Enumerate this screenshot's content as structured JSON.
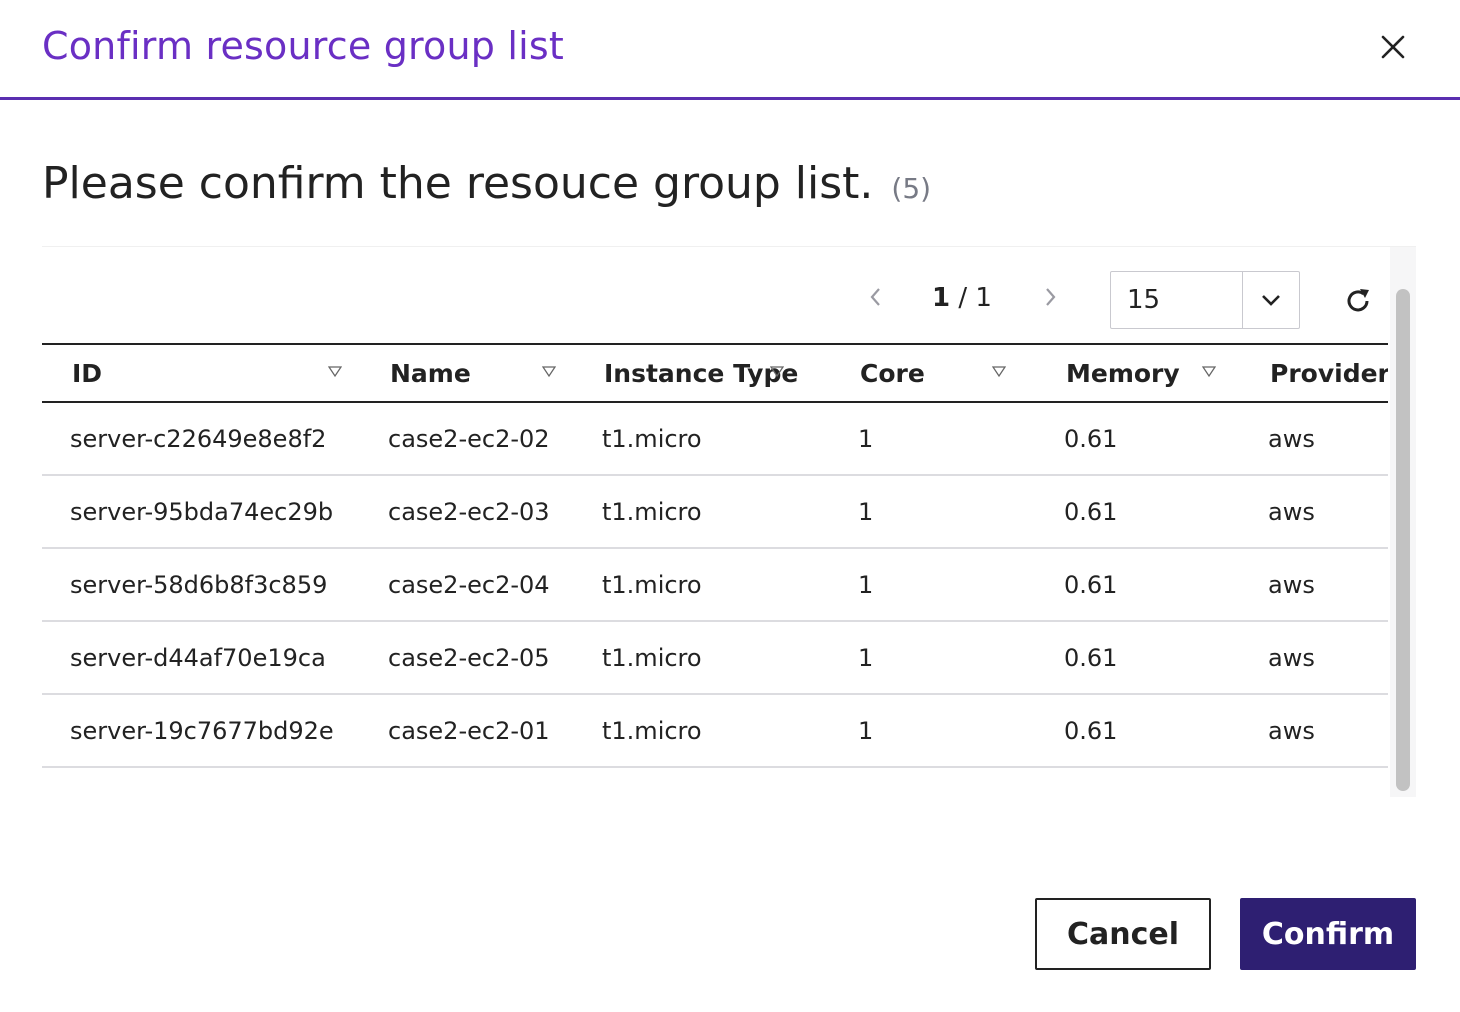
{
  "modal": {
    "title": "Confirm resource group list",
    "close_icon": "close-icon"
  },
  "subtitle": {
    "text": "Please confirm the resouce group list.",
    "count": "(5)"
  },
  "pagination": {
    "current": "1",
    "separator": " / ",
    "total": "1",
    "page_size": "15"
  },
  "table": {
    "columns": [
      "ID",
      "Name",
      "Instance Type",
      "Core",
      "Memory",
      "Provider"
    ],
    "rows": [
      [
        "server-c22649e8e8f2",
        "case2-ec2-02",
        "t1.micro",
        "1",
        "0.61",
        "aws"
      ],
      [
        "server-95bda74ec29b",
        "case2-ec2-03",
        "t1.micro",
        "1",
        "0.61",
        "aws"
      ],
      [
        "server-58d6b8f3c859",
        "case2-ec2-04",
        "t1.micro",
        "1",
        "0.61",
        "aws"
      ],
      [
        "server-d44af70e19ca",
        "case2-ec2-05",
        "t1.micro",
        "1",
        "0.61",
        "aws"
      ],
      [
        "server-19c7677bd92e",
        "case2-ec2-01",
        "t1.micro",
        "1",
        "0.61",
        "aws"
      ]
    ]
  },
  "buttons": {
    "cancel": "Cancel",
    "confirm": "Confirm"
  },
  "colors": {
    "title": "#6a2fc4",
    "header_rule": "#5a2fb0",
    "confirm_bg": "#2e1f72"
  }
}
